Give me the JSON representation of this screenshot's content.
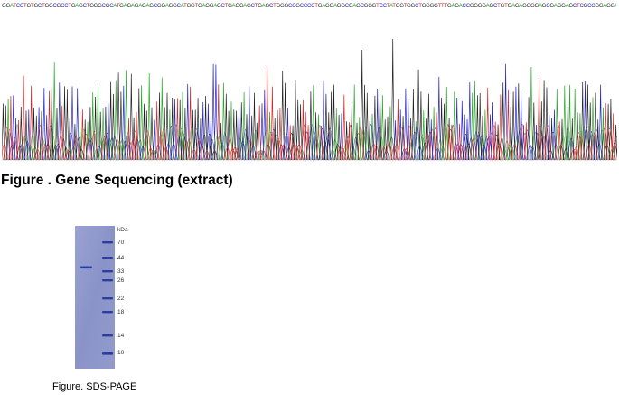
{
  "sequence": {
    "text": "GGATCCTGTGCTGGCGCCTGAGCTGGGCGCATGAGAGAGAGCGGAGGCATGGTGAGGAGCTGAGGAGCTGAGCTGGGCCGCCCCTGAGGAGGCGAGCGGGTCCTATGGTGGCTGGGGTTTGAGACCGGGGAGCTGTGAGAGGGGAGCGAGGAGCTCGCCGGAGGAGGCATCGGAGGACTCCCCAAG",
    "base_colors": {
      "A": "#22aa22",
      "C": "#2222cc",
      "G": "#222222",
      "T": "#dd2222"
    }
  },
  "captions": {
    "gene_sequencing": "Figure . Gene Sequencing (extract)",
    "sds_page": "Figure. SDS-PAGE"
  },
  "gel": {
    "unit": "kDa",
    "markers": [
      "70",
      "44",
      "33",
      "26",
      "22",
      "18",
      "14",
      "10"
    ],
    "lane_color": "#8c95c7",
    "band_color": "#2b3d9e"
  }
}
